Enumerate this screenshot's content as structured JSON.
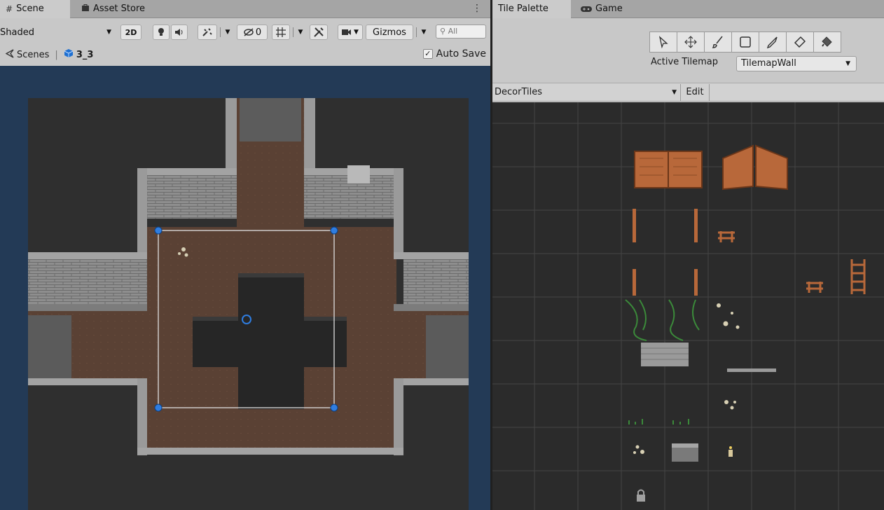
{
  "scene_tabs": {
    "scene": "Scene",
    "asset_store": "Asset Store"
  },
  "toolbar": {
    "draw_mode": "Shaded",
    "mode_2d": "2D",
    "hidden_count": "0",
    "gizmos": "Gizmos",
    "search_placeholder": "All"
  },
  "breadcrumbs": {
    "scenes": "Scenes",
    "current": "3_3"
  },
  "auto_save": {
    "label": "Auto Save",
    "checked": true
  },
  "palette_tabs": {
    "tile_palette": "Tile Palette",
    "game": "Game"
  },
  "palette": {
    "tools": [
      "select-icon",
      "move-icon",
      "brush-icon",
      "box-fill-icon",
      "picker-icon",
      "eraser-icon",
      "fill-icon"
    ],
    "active_tilemap_label": "Active Tilemap",
    "active_tilemap_value": "TilemapWall",
    "palette_name": "DecorTiles",
    "edit_label": "Edit"
  },
  "colors": {
    "scene_bg": "#233a56",
    "dungeon_floor": "#5b4236",
    "stone_wall": "#8a8a8a",
    "pit": "#262626",
    "handle_blue": "#2f7de0",
    "grid_line": "#444444",
    "door_wood": "#b86a35"
  }
}
